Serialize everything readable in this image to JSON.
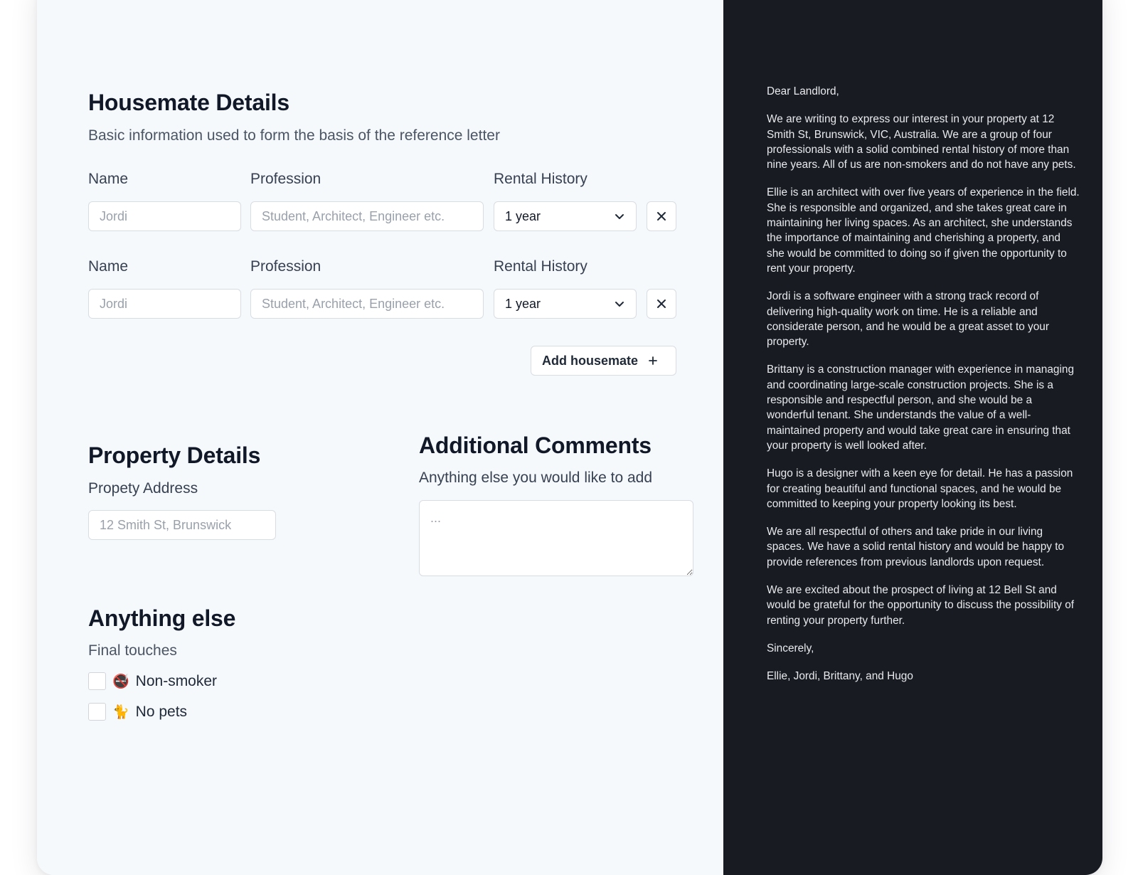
{
  "housemate": {
    "title": "Housemate Details",
    "subtitle": "Basic information used to form the basis of the reference letter",
    "rows": [
      {
        "name_label": "Name",
        "name_placeholder": "Jordi",
        "profession_label": "Profession",
        "profession_placeholder": "Student, Architect, Engineer etc.",
        "rental_label": "Rental History",
        "rental_value": "1 year"
      },
      {
        "name_label": "Name",
        "name_placeholder": "Jordi",
        "profession_label": "Profession",
        "profession_placeholder": "Student, Architect, Engineer etc.",
        "rental_label": "Rental History",
        "rental_value": "1 year"
      }
    ],
    "add_button": "Add housemate",
    "remove_glyph": "✕",
    "add_glyph": "+"
  },
  "property": {
    "title": "Property Details",
    "address_label": "Propety Address",
    "address_placeholder": "12 Smith St, Brunswick"
  },
  "comments": {
    "title": "Additional Comments",
    "subtitle": "Anything else you would like to add",
    "placeholder": "..."
  },
  "extras": {
    "title": "Anything else",
    "subtitle": "Final touches",
    "options": [
      {
        "emoji": "🚭",
        "label": "Non-smoker",
        "checked": false
      },
      {
        "emoji": "🐈",
        "label": "No pets",
        "checked": false
      }
    ]
  },
  "letter": {
    "paragraphs": [
      "Dear Landlord,",
      "We are writing to express our interest in your property at 12 Smith St, Brunswick, VIC, Australia. We are a group of four professionals with a solid combined rental history of more than nine years. All of us are non-smokers and do not have any pets.",
      "Ellie is an architect with over five years of experience in the field. She is responsible and organized, and she takes great care in maintaining her living spaces. As an architect, she understands the importance of maintaining and cherishing a property, and she would be committed to doing so if given the opportunity to rent your property.",
      "Jordi is a software engineer with a strong track record of delivering high-quality work on time. He is a reliable and considerate person, and he would be a great asset to your property.",
      "Brittany is a construction manager with experience in managing and coordinating large-scale construction projects. She is a responsible and respectful person, and she would be a wonderful tenant. She understands the value of a well-maintained property and would take great care in ensuring that your property is well looked after.",
      "Hugo is a designer with a keen eye for detail. He has a passion for creating beautiful and functional spaces, and he would be committed to keeping your property looking its best.",
      "We are all respectful of others and take pride in our living spaces. We have a solid rental history and would be happy to provide references from previous landlords upon request.",
      "We are excited about the prospect of living at 12 Bell St and would be grateful for the opportunity to discuss the possibility of renting your property further.",
      "Sincerely,",
      "Ellie, Jordi, Brittany, and Hugo"
    ]
  },
  "colors": {
    "form_bg": "#f5f9fc",
    "letter_bg": "#181b22",
    "heading": "#111827"
  }
}
